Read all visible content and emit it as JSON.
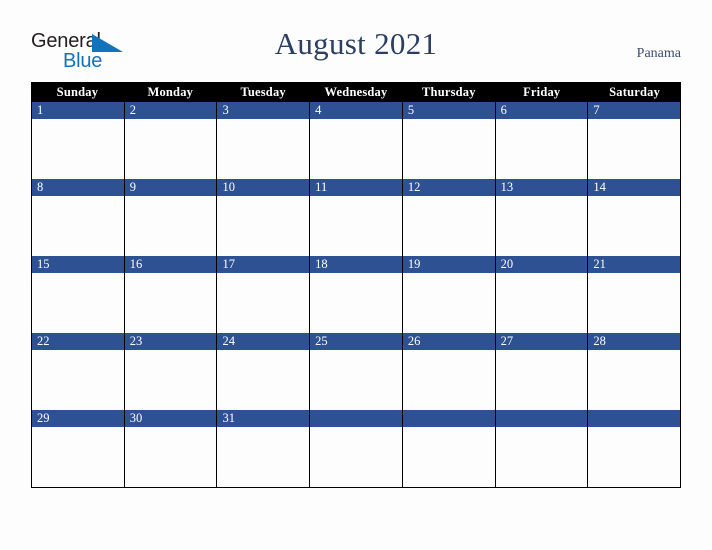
{
  "logo": {
    "word1": "General",
    "word2": "Blue",
    "triangle_icon": "triangle-icon",
    "color_dark": "#231f20",
    "color_blue": "#1173bb"
  },
  "header": {
    "title": "August 2021",
    "country": "Panama",
    "title_color": "#2c3e63",
    "country_color": "#3b4c72"
  },
  "calendar": {
    "weekday_header_bg": "#000000",
    "weekday_header_color": "#ffffff",
    "day_bar_bg": "#2d5193",
    "day_bar_color": "#ffffff",
    "cell_bg": "#fdfdfd",
    "border_color": "#000000",
    "weekdays": [
      "Sunday",
      "Monday",
      "Tuesday",
      "Wednesday",
      "Thursday",
      "Friday",
      "Saturday"
    ],
    "weeks": [
      [
        {
          "day": "1"
        },
        {
          "day": "2"
        },
        {
          "day": "3"
        },
        {
          "day": "4"
        },
        {
          "day": "5"
        },
        {
          "day": "6"
        },
        {
          "day": "7"
        }
      ],
      [
        {
          "day": "8"
        },
        {
          "day": "9"
        },
        {
          "day": "10"
        },
        {
          "day": "11"
        },
        {
          "day": "12"
        },
        {
          "day": "13"
        },
        {
          "day": "14"
        }
      ],
      [
        {
          "day": "15"
        },
        {
          "day": "16"
        },
        {
          "day": "17"
        },
        {
          "day": "18"
        },
        {
          "day": "19"
        },
        {
          "day": "20"
        },
        {
          "day": "21"
        }
      ],
      [
        {
          "day": "22"
        },
        {
          "day": "23"
        },
        {
          "day": "24"
        },
        {
          "day": "25"
        },
        {
          "day": "26"
        },
        {
          "day": "27"
        },
        {
          "day": "28"
        }
      ],
      [
        {
          "day": "29"
        },
        {
          "day": "30"
        },
        {
          "day": "31"
        },
        {
          "day": ""
        },
        {
          "day": ""
        },
        {
          "day": ""
        },
        {
          "day": ""
        }
      ]
    ]
  }
}
